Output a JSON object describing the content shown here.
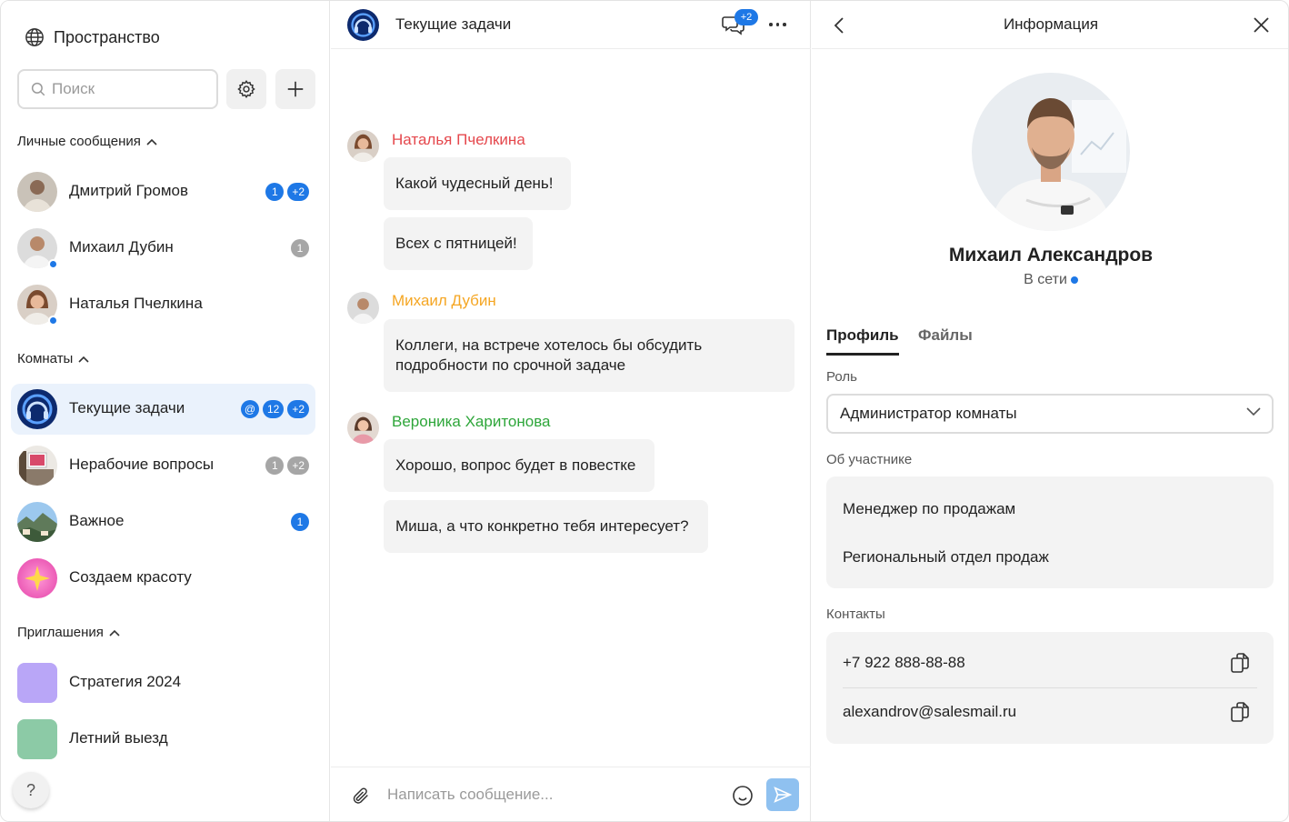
{
  "sidebar": {
    "space_title": "Пространство",
    "search_placeholder": "Поиск",
    "sections": {
      "personal": "Личные сообщения",
      "rooms": "Комнаты",
      "invitations": "Приглашения"
    },
    "personal_chats": [
      {
        "name": "Дмитрий Громов",
        "badges": [
          "1",
          "+2"
        ]
      },
      {
        "name": "Михаил Дубин",
        "badges": [
          "1"
        ]
      },
      {
        "name": "Наталья Пчелкина",
        "badges": []
      }
    ],
    "rooms": [
      {
        "name": "Текущие задачи",
        "badges": [
          "@",
          "12",
          "+2"
        ],
        "active": true
      },
      {
        "name": "Нерабочие вопросы",
        "badges": [
          "1",
          "+2"
        ]
      },
      {
        "name": "Важное",
        "badges": [
          "1"
        ]
      },
      {
        "name": "Создаем красоту",
        "badges": []
      }
    ],
    "invitations": [
      {
        "name": "Стратегия 2024",
        "color": "#b9a6f7"
      },
      {
        "name": "Летний выезд",
        "color": "#8ccaa6"
      }
    ],
    "help_label": "?"
  },
  "chat": {
    "title": "Текущие задачи",
    "threads_badge": "+2",
    "messages": [
      {
        "author": "Наталья Пчелкина",
        "author_color": "#e5484d",
        "bubbles": [
          "Какой чудесный день!",
          "Всех с пятницей!"
        ]
      },
      {
        "author": "Михаил Дубин",
        "author_color": "#f5a623",
        "bubbles": [
          "Коллеги, на встрече хотелось бы обсудить подробности по срочной задаче"
        ]
      },
      {
        "author": "Вероника Харитонова",
        "author_color": "#2ea63a",
        "bubbles": [
          "Хорошо, вопрос будет в повестке",
          "Миша, а что конкретно тебя интересует?"
        ]
      }
    ],
    "composer_placeholder": "Написать сообщение..."
  },
  "info": {
    "title": "Информация",
    "name": "Михаил Александров",
    "status": "В сети",
    "tabs": [
      "Профиль",
      "Файлы"
    ],
    "role_label": "Роль",
    "role_value": "Администратор комнаты",
    "about_label": "Об участнике",
    "about_lines": [
      "Менеджер по продажам",
      "Региональный отдел продаж"
    ],
    "contacts_label": "Контакты",
    "phone": "+7 922 888-88-88",
    "email": "alexandrov@salesmail.ru"
  },
  "colors": {
    "accent": "#1e78e6",
    "active_row": "#eaf2fc",
    "bubble": "#f3f3f3",
    "badge_gray": "#a6a6a6"
  }
}
